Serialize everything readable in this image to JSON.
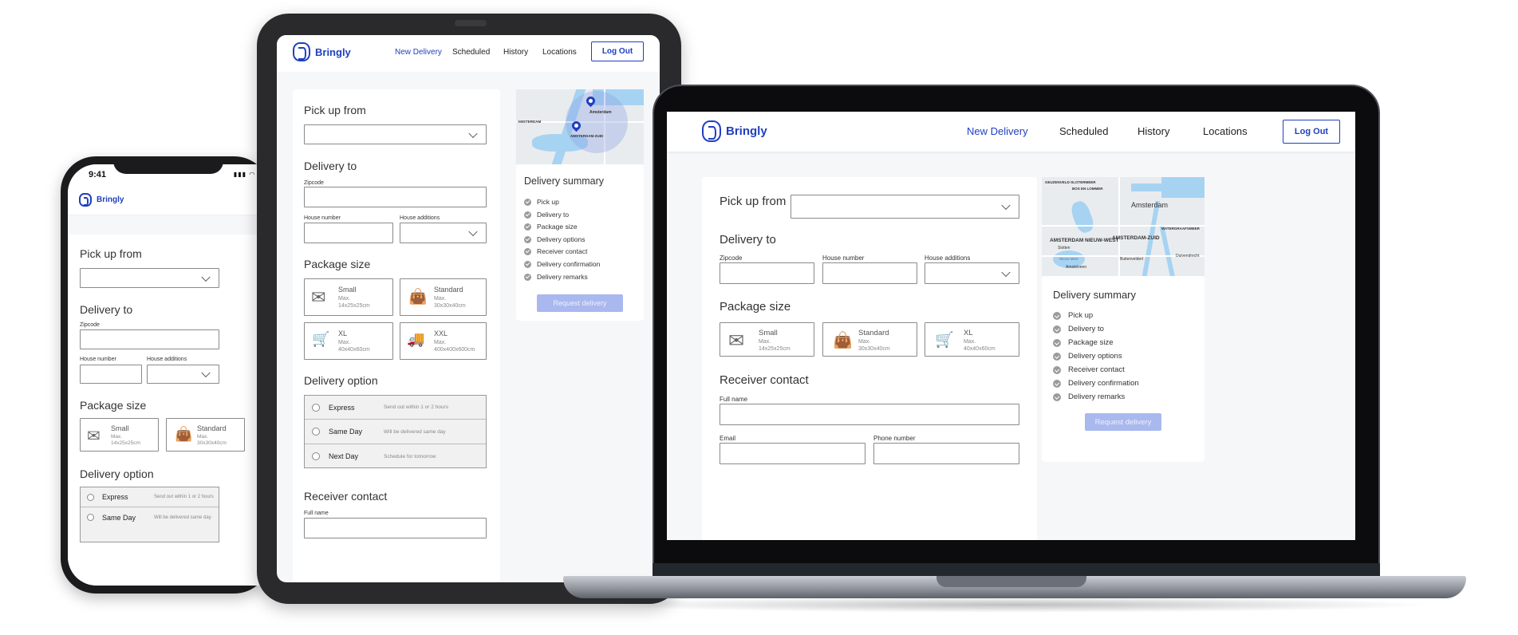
{
  "brand": {
    "name": "Bringly",
    "accent": "#1f3fbf",
    "request_disabled": "#a9b8ee"
  },
  "nav": {
    "new_delivery": "New Delivery",
    "scheduled": "Scheduled",
    "history": "History",
    "locations": "Locations",
    "logout": "Log Out"
  },
  "form": {
    "pickup_title": "Pick up from",
    "delivery_to_title": "Delivery to",
    "zipcode_label": "Zipcode",
    "house_number_label": "House number",
    "house_additions_label": "House additions",
    "package_title": "Package size",
    "packages": [
      {
        "name": "Small",
        "max_label": "Max.",
        "size": "14x25x25cm",
        "icon": "envelope-icon"
      },
      {
        "name": "Standard",
        "max_label": "Max.",
        "size": "30x30x40cm",
        "icon": "shopping-bag-icon"
      },
      {
        "name": "XL",
        "max_label": "Max.",
        "size": "40x40x60cm",
        "icon": "hand-truck-icon"
      },
      {
        "name": "XXL",
        "max_label": "Max.",
        "size": "400x400x600cm",
        "icon": "delivery-truck-icon"
      }
    ],
    "option_title": "Delivery option",
    "options": [
      {
        "name": "Express",
        "desc": "Send out within 1 or 2 hours"
      },
      {
        "name": "Same Day",
        "desc": "Will be delivered same day"
      },
      {
        "name": "Next Day",
        "desc": "Schedule for tomorrow"
      }
    ],
    "receiver_title": "Receiver contact",
    "full_name_label": "Full name",
    "email_label": "Email",
    "phone_label": "Phone number"
  },
  "summary": {
    "title": "Delivery summary",
    "items": [
      "Pick up",
      "Delivery to",
      "Package size",
      "Delivery options",
      "Receiver contact",
      "Delivery confirmation",
      "Delivery remarks"
    ],
    "request_button": "Request delivery"
  },
  "map": {
    "labels": [
      "Amsterdam",
      "AMSTERDAM NIEUW-WEST",
      "AMSTERDAM-ZUID",
      "GEUZENVELD-SLOTERMEER",
      "BOS EN LOMMER",
      "WATERGRAAFSMEER",
      "Slotten",
      "Buitenveldert",
      "Amstelveen",
      "Duivendrecht",
      "Nieuw Meer",
      "AMSTERDAM",
      "AMSTERDAM-ZUID",
      "Amsterdam"
    ]
  },
  "phone": {
    "time": "9:41",
    "status_icons": "▮▮▮ ◠ ▭"
  }
}
